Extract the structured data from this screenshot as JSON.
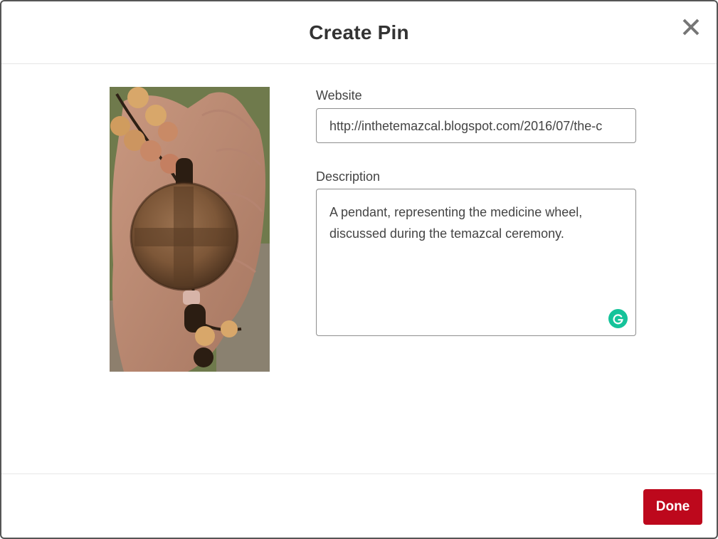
{
  "header": {
    "title": "Create Pin",
    "close_icon": "close-icon"
  },
  "pin": {
    "image_subject": "hand-holding-wooden-medicine-wheel-pendant"
  },
  "form": {
    "website_label": "Website",
    "website_value": "http://inthetemazcal.blogspot.com/2016/07/the-c",
    "description_label": "Description",
    "description_value": "A pendant, representing the medicine wheel, discussed during the temazcal ceremony.",
    "grammarly_icon": "grammarly-icon"
  },
  "footer": {
    "done_label": "Done"
  },
  "colors": {
    "done_button": "#bd081c",
    "grammarly": "#15c39a",
    "title_text": "#333333",
    "close_icon": "#767676"
  }
}
